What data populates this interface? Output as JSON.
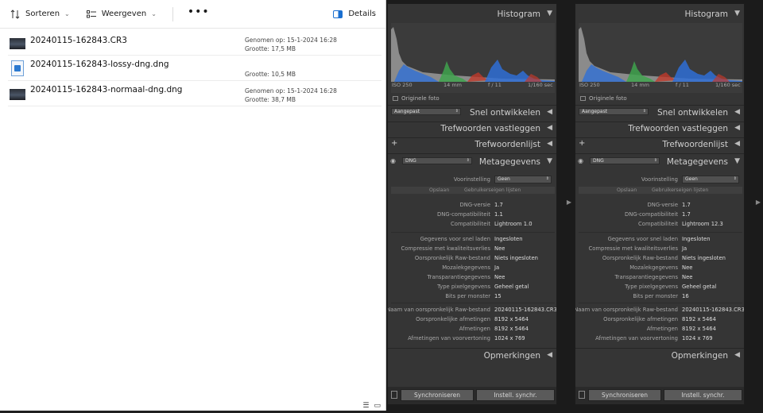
{
  "explorer": {
    "toolbar": {
      "sort_label": "Sorteren",
      "view_label": "Weergeven",
      "more_label": "•••",
      "details_label": "Details"
    },
    "files": [
      {
        "name": "20240115-162843.CR3",
        "icon": "raw-photo-thumbnail",
        "taken_label": "Genomen op:",
        "taken_value": "15-1-2024 16:28",
        "size_label": "Grootte:",
        "size_value": "17,5 MB"
      },
      {
        "name": "20240115-162843-lossy-dng.dng",
        "icon": "dng-file-icon",
        "size_label": "Grootte:",
        "size_value": "10,5 MB"
      },
      {
        "name": "20240115-162843-normaal-dng.dng",
        "icon": "raw-photo-thumbnail",
        "taken_label": "Genomen op:",
        "taken_value": "15-1-2024 16:28",
        "size_label": "Grootte:",
        "size_value": "38,7 MB"
      }
    ]
  },
  "panels": [
    {
      "histogram_title": "Histogram",
      "hist_iso": "ISO 250",
      "hist_focal": "14 mm",
      "hist_aperture": "f / 11",
      "hist_shutter": "1/160 sec",
      "original_photo": "Originele foto",
      "quick_develop_preset": "Aangepast",
      "quick_develop_title": "Snel ontwikkelen",
      "keywording_title": "Trefwoorden vastleggen",
      "keyword_list_title": "Trefwoordenlijst",
      "metadata_preset": "DNG",
      "metadata_title": "Metagegevens",
      "preset_label": "Voorinstelling",
      "preset_value": "Geen",
      "tab_operation": "Opslaan",
      "tab_customize": "Gebruikerseigen lijsten",
      "rows_a": [
        {
          "k": "DNG-versie",
          "v": "1.7"
        },
        {
          "k": "DNG-compatibiliteit",
          "v": "1.1"
        },
        {
          "k": "Compatibiliteit",
          "v": "Lightroom 1.0"
        }
      ],
      "rows_b": [
        {
          "k": "Gegevens voor snel laden",
          "v": "Ingesloten"
        },
        {
          "k": "Compressie met kwaliteitsverlies",
          "v": "Nee"
        },
        {
          "k": "Oorspronkelijk Raw-bestand",
          "v": "Niets ingesloten"
        },
        {
          "k": "Mozaïekgegevens",
          "v": "Ja"
        },
        {
          "k": "Transparantiegegevens",
          "v": "Nee"
        },
        {
          "k": "Type pixelgegevens",
          "v": "Geheel getal"
        },
        {
          "k": "Bits per monster",
          "v": "15"
        }
      ],
      "rows_c": [
        {
          "k": "Naam van oorspronkelijk Raw-bestand",
          "v": "20240115-162843.CR3"
        },
        {
          "k": "Oorspronkelijke afmetingen",
          "v": "8192 x 5464"
        },
        {
          "k": "Afmetingen",
          "v": "8192 x 5464"
        },
        {
          "k": "Afmetingen van voorvertoning",
          "v": "1024 x 769"
        }
      ],
      "comments_title": "Opmerkingen",
      "sync_label": "Synchroniseren",
      "sync_settings_label": "Instell. synchr."
    },
    {
      "histogram_title": "Histogram",
      "hist_iso": "ISO 250",
      "hist_focal": "14 mm",
      "hist_aperture": "f / 11",
      "hist_shutter": "1/160 sec",
      "original_photo": "Originele foto",
      "quick_develop_preset": "Aangepast",
      "quick_develop_title": "Snel ontwikkelen",
      "keywording_title": "Trefwoorden vastleggen",
      "keyword_list_title": "Trefwoordenlijst",
      "metadata_preset": "DNG",
      "metadata_title": "Metagegevens",
      "preset_label": "Voorinstelling",
      "preset_value": "Geen",
      "tab_operation": "Opslaan",
      "tab_customize": "Gebruikerseigen lijsten",
      "rows_a": [
        {
          "k": "DNG-versie",
          "v": "1.7"
        },
        {
          "k": "DNG-compatibiliteit",
          "v": "1.7"
        },
        {
          "k": "Compatibiliteit",
          "v": "Lightroom 12.3"
        }
      ],
      "rows_b": [
        {
          "k": "Gegevens voor snel laden",
          "v": "Ingesloten"
        },
        {
          "k": "Compressie met kwaliteitsverlies",
          "v": "Ja"
        },
        {
          "k": "Oorspronkelijk Raw-bestand",
          "v": "Niets ingesloten"
        },
        {
          "k": "Mozaïekgegevens",
          "v": "Nee"
        },
        {
          "k": "Transparantiegegevens",
          "v": "Nee"
        },
        {
          "k": "Type pixelgegevens",
          "v": "Geheel getal"
        },
        {
          "k": "Bits per monster",
          "v": "16"
        }
      ],
      "rows_c": [
        {
          "k": "Naam van oorspronkelijk Raw-bestand",
          "v": "20240115-162843.CR3"
        },
        {
          "k": "Oorspronkelijke afmetingen",
          "v": "8192 x 5464"
        },
        {
          "k": "Afmetingen",
          "v": "8192 x 5464"
        },
        {
          "k": "Afmetingen van voorvertoning",
          "v": "1024 x 769"
        }
      ],
      "comments_title": "Opmerkingen",
      "sync_label": "Synchroniseren",
      "sync_settings_label": "Instell. synchr."
    }
  ],
  "colors": {
    "explorer_bg": "#ffffff",
    "lr_panel_bg": "#353535",
    "lr_text": "#c9c9c9",
    "hist_red": "#c0392b",
    "hist_green": "#3fa34d",
    "hist_blue": "#2f6fd6",
    "hist_gray": "#9a9a9a"
  }
}
